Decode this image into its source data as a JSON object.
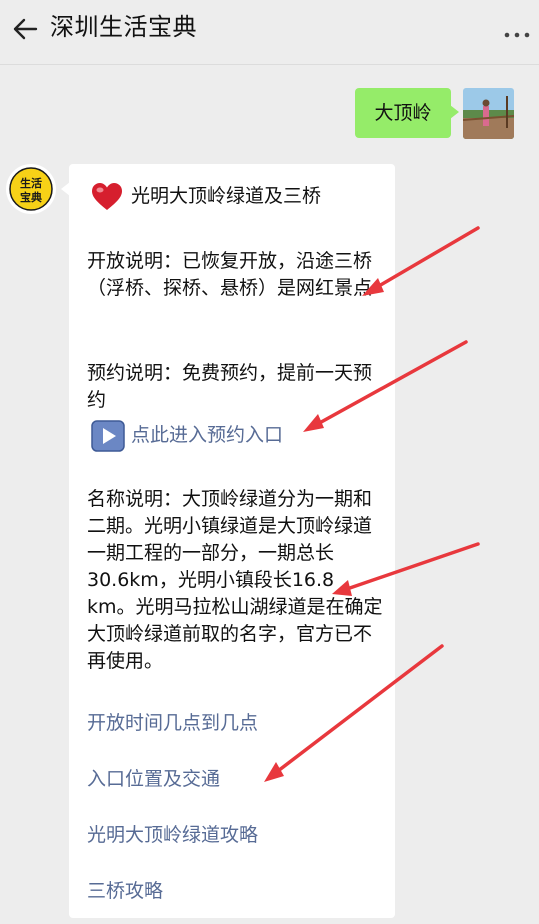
{
  "header": {
    "title": "深圳生活宝典"
  },
  "chat": {
    "user_message": "大顶岭",
    "bot_avatar_text": [
      "生活",
      "宝典"
    ],
    "bot": {
      "heading": "光明大顶岭绿道及三桥",
      "open_note": "开放说明：已恢复开放，沿途三桥（浮桥、探桥、悬桥）是网红景点",
      "booking_note": "预约说明：免费预约，提前一天预约",
      "booking_link": "点此进入预约入口",
      "name_note": "名称说明：大顶岭绿道分为一期和二期。光明小镇绿道是大顶岭绿道一期工程的一部分，一期总长30.6km，光明小镇段长16.8 km。光明马拉松山湖绿道是在确定大顶岭绿道前取的名字，官方已不再使用。",
      "links": [
        "开放时间几点到几点",
        "入口位置及交通",
        "光明大顶岭绿道攻略",
        "三桥攻略"
      ]
    }
  },
  "colors": {
    "bubble_green": "#95ec69",
    "link_blue": "#576b95",
    "annotation_red": "#e8383d",
    "background": "#ededed"
  }
}
